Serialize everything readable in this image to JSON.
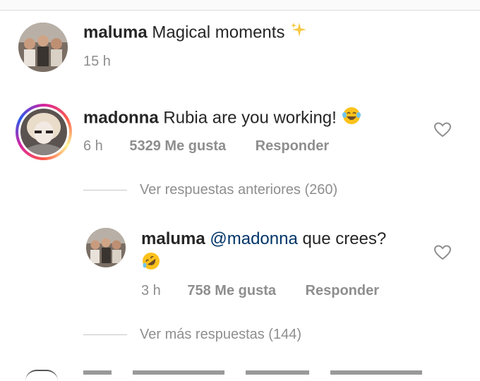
{
  "caption": {
    "username": "maluma",
    "text": "Magical moments",
    "emoji_icon": "sparkles-icon",
    "time": "15 h"
  },
  "comment": {
    "username": "madonna",
    "text": "Rubia are you working!",
    "emoji_icon": "laughing-tears-emoji-icon",
    "time": "6 h",
    "likes": "5329 Me gusta",
    "reply_label": "Responder",
    "view_previous": "Ver respuestas anteriores (260)"
  },
  "reply": {
    "username": "maluma",
    "mention": "@madonna",
    "text": "que crees?",
    "emoji_icon": "rolling-laughing-emoji-icon",
    "time": "3 h",
    "likes": "758 Me gusta",
    "reply_label": "Responder",
    "view_more": "Ver más respuestas (144)"
  },
  "colors": {
    "mention": "#003569",
    "muted": "#8e8e8e",
    "text": "#262626"
  }
}
